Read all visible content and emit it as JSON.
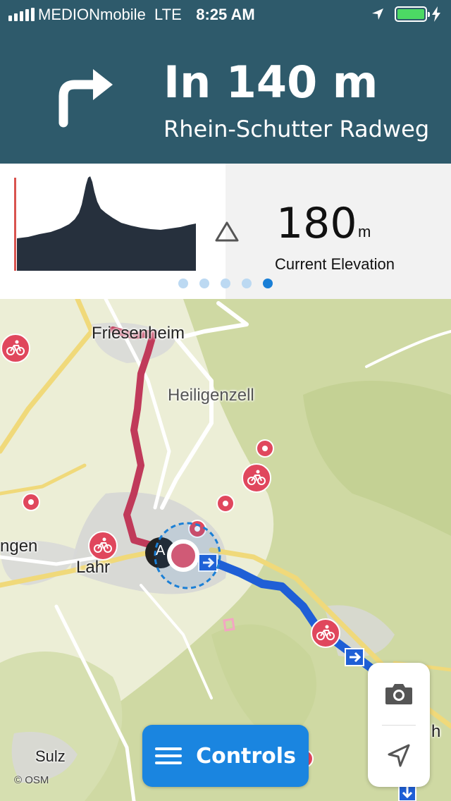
{
  "status_bar": {
    "carrier": "MEDIONmobile",
    "network": "LTE",
    "time": "8:25 AM",
    "battery_level": 1.0,
    "battery_color": "#4cd964"
  },
  "navigation": {
    "distance": "In 140 m",
    "street": "Rhein-Schutter Radweg",
    "turn_icon": "turn-right-icon",
    "banner_color": "#2e5a6b"
  },
  "elevation": {
    "value": "180",
    "unit": "m",
    "label": "Current Elevation",
    "icon": "triangle-outline-icon",
    "pager": {
      "count": 5,
      "active_index": 4
    }
  },
  "map": {
    "places": [
      "Friesenheim",
      "Heiligenzell",
      "Lahr",
      "ngen",
      "Sulz"
    ],
    "partial_label": "h",
    "marker_label": "A",
    "attribution": "© OSM",
    "route_traveled_color": "#c03a5a",
    "route_ahead_color": "#1f5fd6",
    "poi_color": "#e0475d"
  },
  "map_tools": {
    "camera_icon": "camera-icon",
    "locate_icon": "location-arrow-icon"
  },
  "controls": {
    "label": "Controls",
    "icon": "hamburger-menu-icon"
  }
}
